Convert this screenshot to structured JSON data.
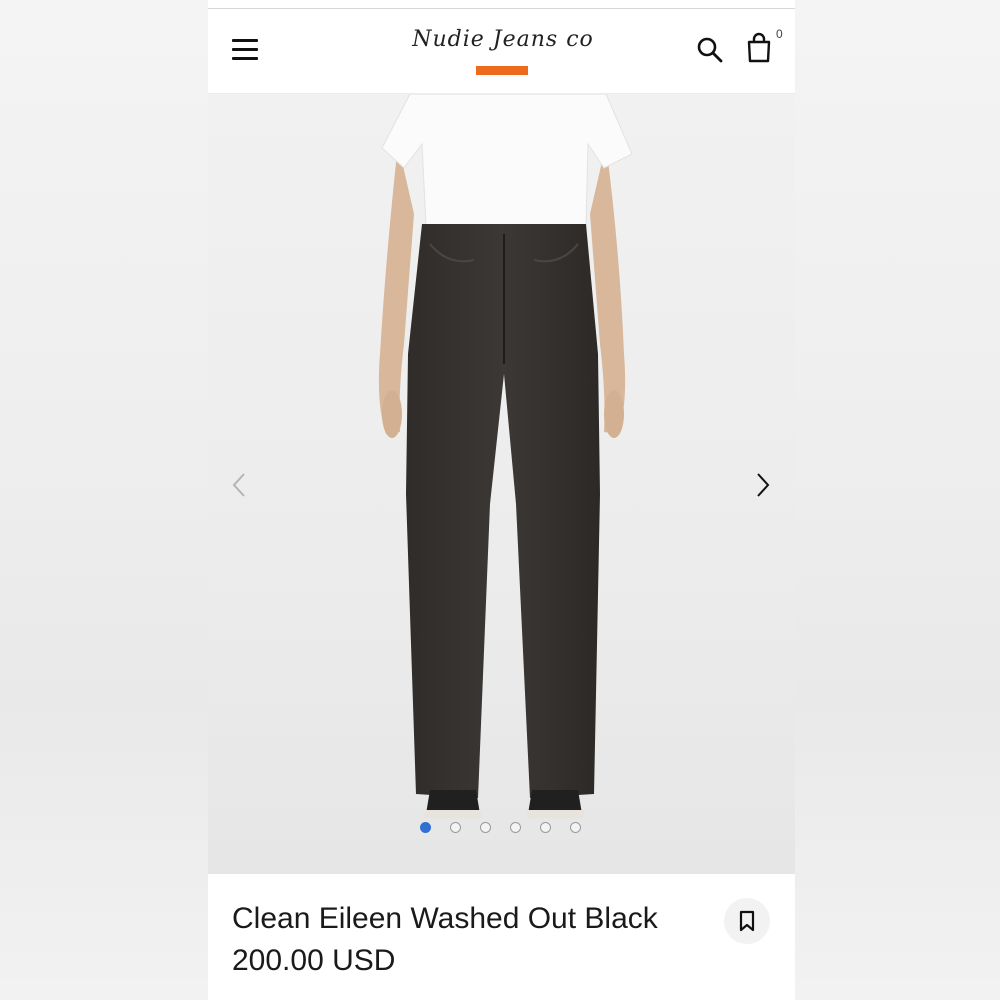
{
  "header": {
    "brand": "Nudie Jeans co",
    "cart_count": "0",
    "accent_color": "#ee6a1c"
  },
  "icons": {
    "menu": "hamburger-menu-icon",
    "search": "search-icon",
    "cart": "shopping-bag-icon",
    "prev": "chevron-left-icon",
    "next": "chevron-right-icon",
    "wishlist": "bookmark-icon"
  },
  "gallery": {
    "image_count": 6,
    "active_index": 0,
    "active_dot_color": "#2f6fd6"
  },
  "product": {
    "title": "Clean Eileen Washed Out Black",
    "price": "200.00 USD"
  }
}
